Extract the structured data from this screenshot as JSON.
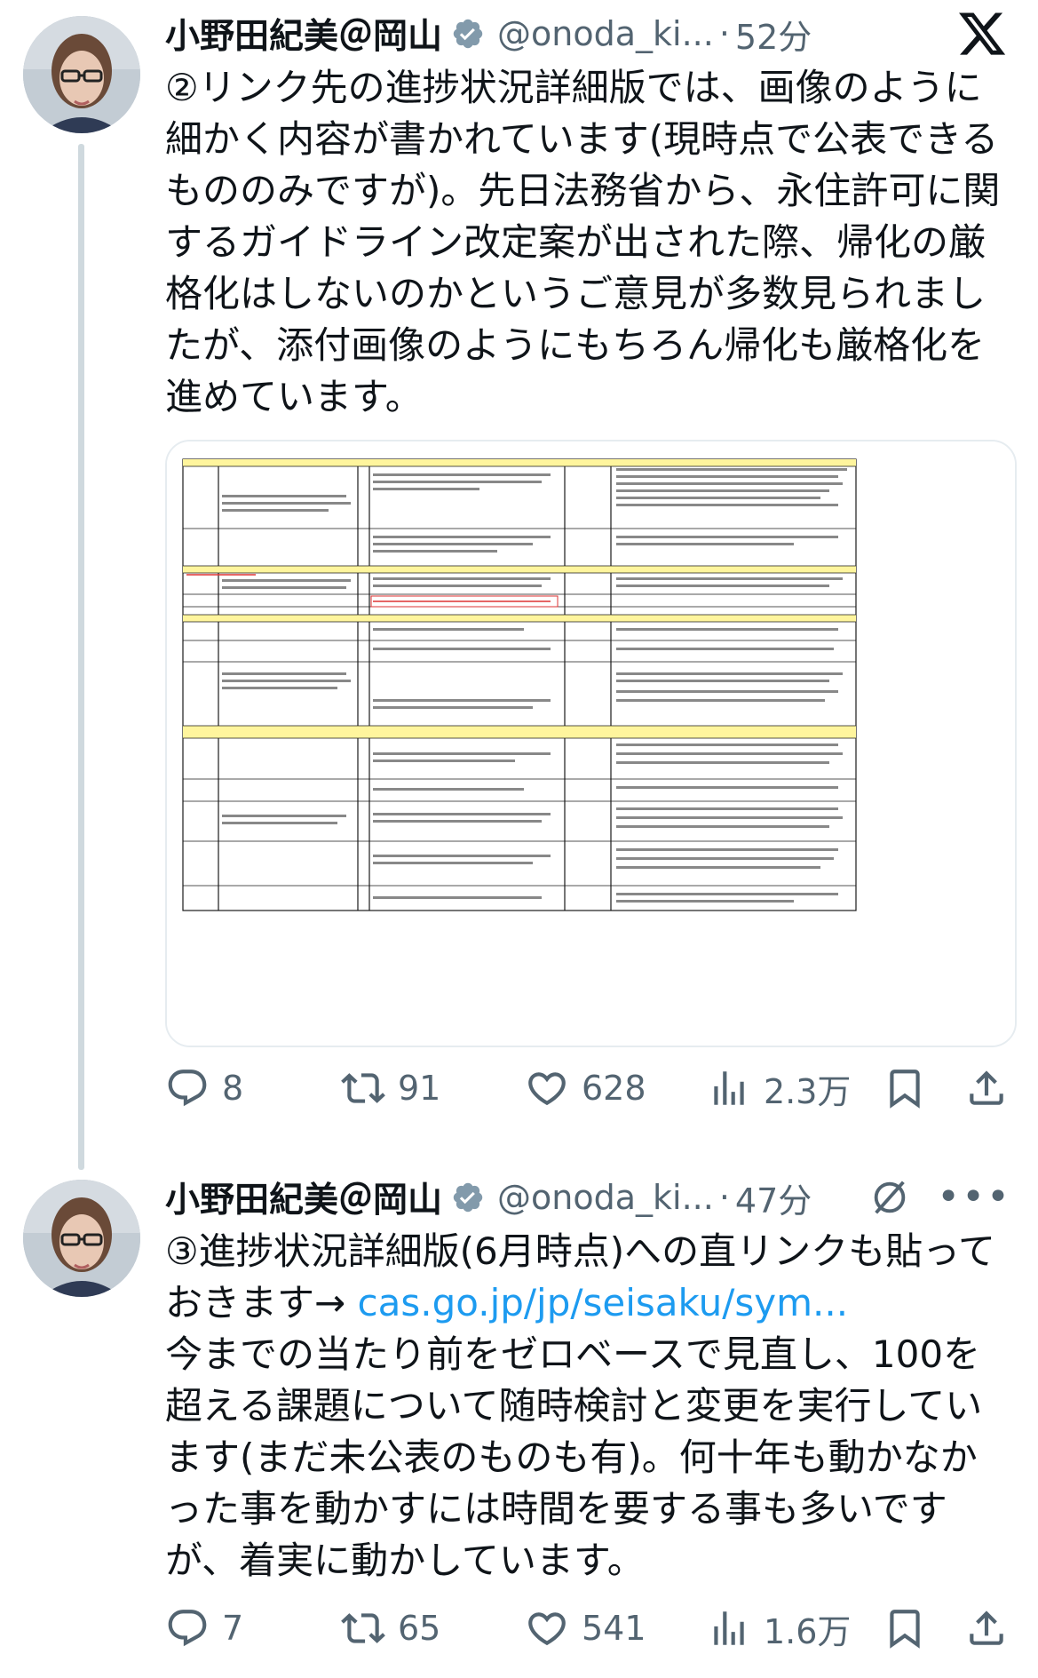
{
  "tweets": [
    {
      "display_name": "小野田紀美＠岡山",
      "handle": "@onoda_ki...",
      "separator": "·",
      "time": "52分",
      "text": "②リンク先の進捗状況詳細版では、画像のように細かく内容が書かれています(現時点で公表できるもののみですが)。先日法務省から、永住許可に関するガイドライン改定案が出された際、帰化の厳格化はしないのかというご意見が多数見られましたが、添付画像のようにもちろん帰化も厳格化を進めています。",
      "counts": {
        "replies": "8",
        "retweets": "91",
        "likes": "628",
        "views": "2.3万"
      },
      "header_icon": "x-logo-icon"
    },
    {
      "display_name": "小野田紀美＠岡山",
      "handle": "@onoda_ki...",
      "separator": "·",
      "time": "47分",
      "text_before_link": "③進捗状況詳細版(6月時点)への直リンクも貼っておきます→ ",
      "link_text": "cas.go.jp/jp/seisaku/sym...",
      "text_after_link": "\n今までの当たり前をゼロベースで見直し、100を超える課題について随時検討と変更を実行しています(まだ未公表のものも有)。何十年も動かなかった事を動かすには時間を要する事も多いですが、着実に動かしています。",
      "counts": {
        "replies": "7",
        "retweets": "65",
        "likes": "541",
        "views": "1.6万"
      },
      "header_icons": [
        "grok-icon",
        "more-icon"
      ]
    }
  ],
  "colors": {
    "text": "#0f1419",
    "muted": "#536471",
    "link": "#1d9bf0",
    "verified_badge": "#829aab",
    "thread_line": "#cfd9de"
  }
}
